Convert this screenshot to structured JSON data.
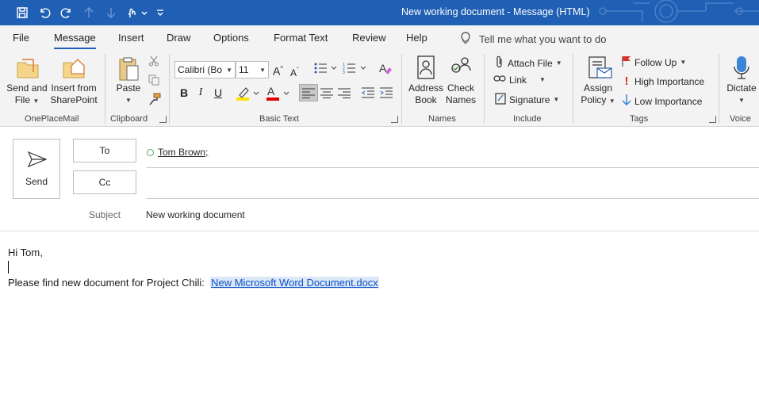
{
  "window": {
    "title": "New working document  -  Message (HTML)"
  },
  "qat": {
    "icons": [
      "save-icon",
      "undo-icon",
      "redo-icon",
      "up-arrow-icon",
      "down-arrow-icon",
      "touch-mode-icon",
      "customize-icon"
    ]
  },
  "tabs": [
    {
      "label": "File"
    },
    {
      "label": "Message",
      "active": true
    },
    {
      "label": "Insert"
    },
    {
      "label": "Draw"
    },
    {
      "label": "Options"
    },
    {
      "label": "Format Text"
    },
    {
      "label": "Review"
    },
    {
      "label": "Help"
    }
  ],
  "tellme": {
    "placeholder": "Tell me what you want to do"
  },
  "ribbon": {
    "oneplacemail": {
      "label": "OnePlaceMail",
      "send_and_file_1": "Send and",
      "send_and_file_2": "File",
      "insert_sp_1": "Insert from",
      "insert_sp_2": "SharePoint"
    },
    "clipboard": {
      "label": "Clipboard",
      "paste": "Paste"
    },
    "basic_text": {
      "label": "Basic Text",
      "font": "Calibri (Bo",
      "size": "11"
    },
    "names": {
      "label": "Names",
      "address_1": "Address",
      "address_2": "Book",
      "check_1": "Check",
      "check_2": "Names"
    },
    "include": {
      "label": "Include",
      "attach": "Attach File",
      "link": "Link",
      "signature": "Signature"
    },
    "tags": {
      "label": "Tags",
      "assign_1": "Assign",
      "assign_2": "Policy",
      "follow_up": "Follow Up",
      "high": "High Importance",
      "low": "Low Importance"
    },
    "voice": {
      "label": "Voice",
      "dictate": "Dictate"
    }
  },
  "header": {
    "send": "Send",
    "to": "To",
    "cc": "Cc",
    "recipient": "Tom Brown;",
    "subject_label": "Subject",
    "subject_value": "New working document"
  },
  "body": {
    "greeting": "Hi Tom,",
    "line": "Please find new document for Project Chili:",
    "link": "New Microsoft Word Document.docx"
  },
  "colors": {
    "titlebar": "#1f5fb4",
    "ribbon": "#f3f3f3",
    "link": "#0b50c8",
    "highlight_yellow": "#ffe100",
    "font_red": "#e00000",
    "importance_red": "#d93025",
    "low_blue": "#2f7fd4"
  }
}
